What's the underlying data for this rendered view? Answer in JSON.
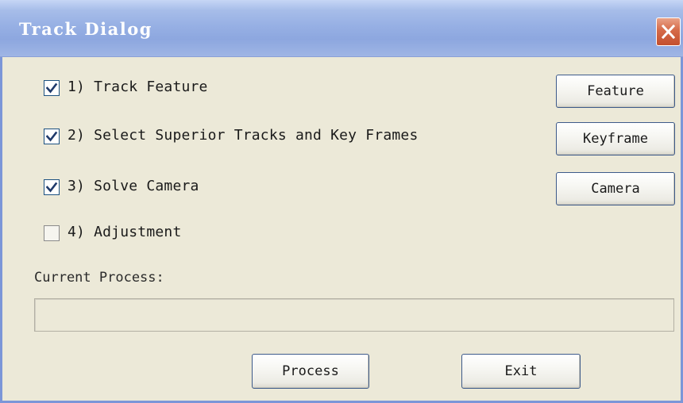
{
  "window": {
    "title": "Track Dialog",
    "close_glyph": "X"
  },
  "steps": [
    {
      "label": "1) Track Feature",
      "checked": true
    },
    {
      "label": "2) Select Superior Tracks and Key Frames",
      "checked": true
    },
    {
      "label": "3) Solve Camera",
      "checked": true
    },
    {
      "label": "4) Adjustment",
      "checked": false
    }
  ],
  "side_buttons": {
    "feature": "Feature",
    "keyframe": "Keyframe",
    "camera": "Camera"
  },
  "current_process": {
    "label": "Current Process:",
    "progress": 0
  },
  "footer": {
    "process": "Process",
    "exit": "Exit"
  },
  "colors": {
    "dialog_background": "#ece9d8",
    "titlebar": "#97b0e4",
    "close_button": "#d56a48",
    "checkbox_border": "#1c5180",
    "button_border": "#3d5a8a"
  },
  "icons": {
    "close": "close-icon",
    "check": "checkmark-icon"
  }
}
